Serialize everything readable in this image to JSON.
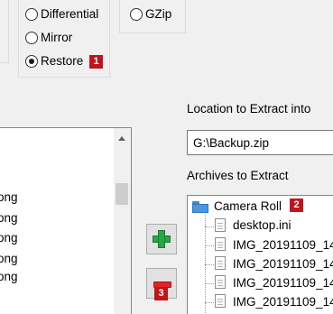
{
  "mode_options": {
    "differential": "Differential",
    "mirror": "Mirror",
    "restore": "Restore",
    "selected": "restore"
  },
  "compression_options": {
    "gzip": "GZip"
  },
  "badges": {
    "restore": "1",
    "archives": "2",
    "remove": "3"
  },
  "location": {
    "label": "Location to Extract into",
    "value": "G:\\Backup.zip"
  },
  "archives": {
    "label": "Archives to Extract",
    "root": "Camera Roll",
    "items": [
      "desktop.ini",
      "IMG_20191109_14",
      "IMG_20191109_14",
      "IMG_20191109_14",
      "IMG_20191109_14"
    ]
  },
  "left_list": {
    "rows": [
      "ong",
      "ong",
      "ong",
      "ong",
      "ong"
    ]
  },
  "icons": {
    "add": "plus-icon",
    "remove": "minus-icon",
    "folder": "folder-icon",
    "file": "file-icon"
  },
  "colors": {
    "badge": "#c0151c",
    "add_green": "#28a745",
    "remove_red": "#e0242c",
    "folder_blue": "#4a96e0"
  }
}
